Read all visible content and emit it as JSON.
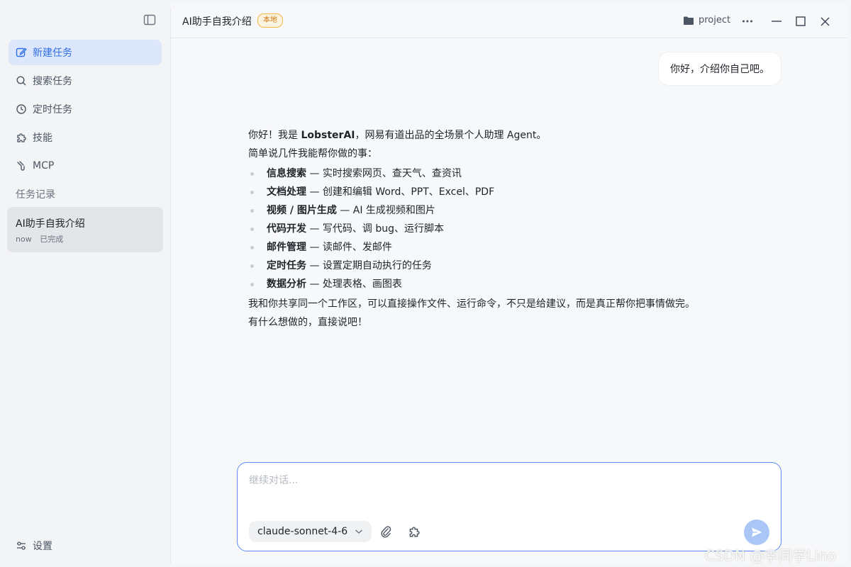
{
  "sidebar": {
    "toggle_icon": "sidebar-panel-icon",
    "items": [
      {
        "label": "新建任务",
        "icon": "edit-icon",
        "active": true
      },
      {
        "label": "搜索任务",
        "icon": "search-icon"
      },
      {
        "label": "定时任务",
        "icon": "clock-icon"
      },
      {
        "label": "技能",
        "icon": "puzzle-icon"
      },
      {
        "label": "MCP",
        "icon": "mcp-icon"
      }
    ],
    "history_title": "任务记录",
    "tasks": [
      {
        "title": "AI助手自我介绍",
        "time": "now",
        "status": "已完成"
      }
    ],
    "settings_label": "设置"
  },
  "header": {
    "title": "AI助手自我介绍",
    "badge": "本地",
    "project_label": "project"
  },
  "chat": {
    "user_message": "你好，介绍你自己吧。",
    "assistant": {
      "intro_pre": "你好！我是 ",
      "intro_name": "LobsterAI",
      "intro_post": "，网易有道出品的全场景个人助理 Agent。",
      "lead": "简单说几件我能帮你做的事：",
      "items": [
        {
          "title": "信息搜索",
          "desc": " — 实时搜索网页、查天气、查资讯"
        },
        {
          "title": "文档处理",
          "desc": " — 创建和编辑 Word、PPT、Excel、PDF"
        },
        {
          "title": "视频 / 图片生成",
          "desc": " — AI 生成视频和图片"
        },
        {
          "title": "代码开发",
          "desc": " — 写代码、调 bug、运行脚本"
        },
        {
          "title": "邮件管理",
          "desc": " — 读邮件、发邮件"
        },
        {
          "title": "定时任务",
          "desc": " — 设置定期自动执行的任务"
        },
        {
          "title": "数据分析",
          "desc": " — 处理表格、画图表"
        }
      ],
      "closing1": "我和你共享同一个工作区，可以直接操作文件、运行命令，不只是给建议，而是真正帮你把事情做完。",
      "closing2": "有什么想做的，直接说吧！"
    }
  },
  "composer": {
    "placeholder": "继续对话...",
    "value": "",
    "model": "claude-sonnet-4-6"
  },
  "watermark": "CSDN @李同学Lino",
  "colors": {
    "accent": "#2f6fe4",
    "active_bg": "#dde7fb",
    "badge_border": "#f5b54a",
    "send_bg": "#a9c6f7"
  }
}
